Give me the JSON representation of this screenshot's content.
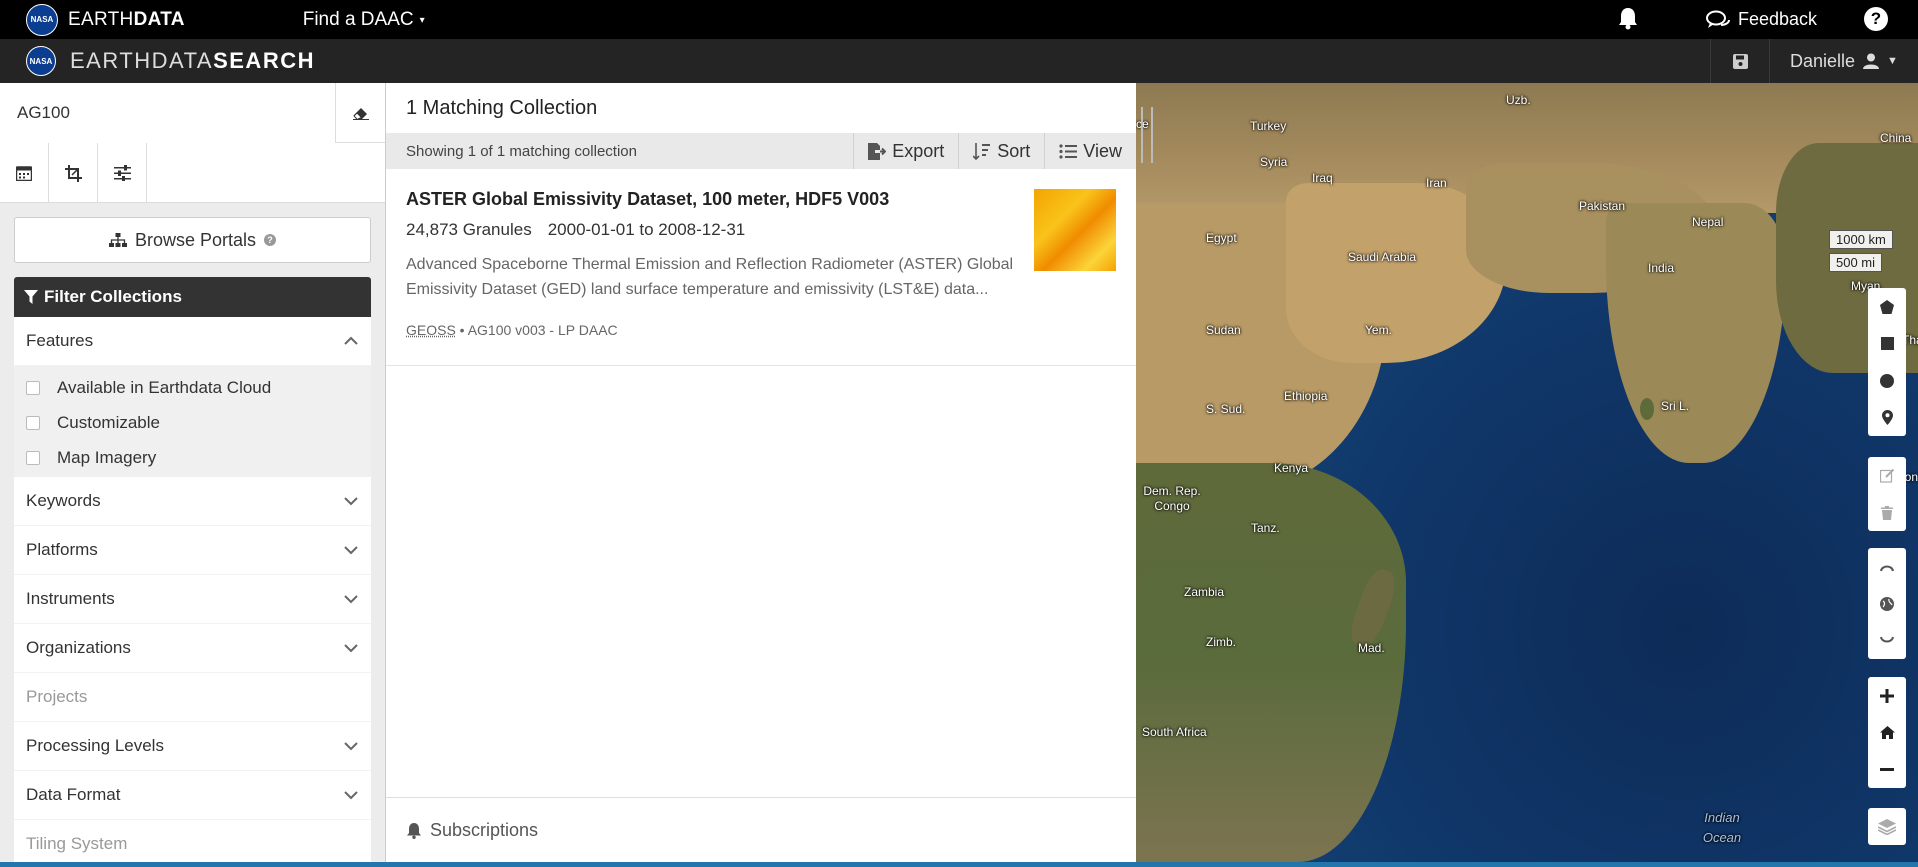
{
  "topbar": {
    "brand_prefix": "EARTH",
    "brand_suffix": "DATA",
    "find_daac": "Find a DAAC",
    "feedback": "Feedback"
  },
  "searchbar": {
    "title_prefix": "EARTHDATA",
    "title_suffix": "SEARCH",
    "user": "Danielle"
  },
  "sidebar": {
    "search_value": "AG100",
    "browse_portals": "Browse Portals",
    "filter_header": "Filter Collections",
    "features_label": "Features",
    "features": [
      "Available in Earthdata Cloud",
      "Customizable",
      "Map Imagery"
    ],
    "facets": [
      "Keywords",
      "Platforms",
      "Instruments",
      "Organizations",
      "Projects",
      "Processing Levels",
      "Data Format",
      "Tiling System"
    ]
  },
  "results": {
    "title": "1 Matching Collection",
    "showing": "Showing 1 of 1 matching collection",
    "export": "Export",
    "sort": "Sort",
    "view": "View",
    "collection": {
      "title": "ASTER Global Emissivity Dataset, 100 meter, HDF5 V003",
      "granules": "24,873 Granules",
      "dates": "2000-01-01 to 2008-12-31",
      "description": "Advanced Spaceborne Thermal Emission and Reflection Radiometer (ASTER) Global Emissivity Dataset (GED) land surface temperature and emissivity (LST&E) data...",
      "tag": "GEOSS",
      "footer": " • AG100 v003 - LP DAAC"
    },
    "subscriptions": "Subscriptions"
  },
  "map": {
    "scale_km": "1000 km",
    "scale_mi": "500 mi",
    "labels": [
      "Turkey",
      "Syria",
      "Iraq",
      "Iran",
      "Pakistan",
      "Nepal",
      "China",
      "Uzb.",
      "Egypt",
      "Saudi Arabia",
      "India",
      "Myan.",
      "Sudan",
      "Yem.",
      "Thai",
      "Ethiopia",
      "S. Sud.",
      "Sri L.",
      "Kenya",
      "Dem. Rep. Congo",
      "Indon",
      "Tanz.",
      "Zambia",
      "Zimb.",
      "Mad.",
      "South Africa",
      "Indian Ocean",
      "ce"
    ]
  }
}
